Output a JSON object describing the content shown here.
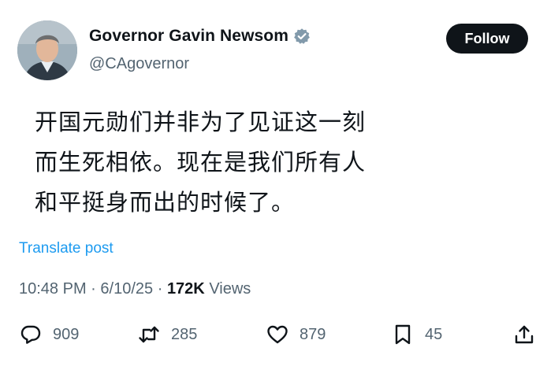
{
  "author": {
    "display_name": "Governor Gavin Newsom",
    "handle": "@CAgovernor",
    "verified_icon": "verified-badge-icon",
    "badge_color": "#829aab"
  },
  "follow_label": "Follow",
  "tweet": {
    "lines": [
      "开国元勋们并非为了见证这一刻",
      "而生死相依。现在是我们所有人",
      "和平挺身而出的时候了。"
    ]
  },
  "translate_label": "Translate post",
  "meta": {
    "time": "10:48 PM",
    "separator": "·",
    "date": "6/10/25",
    "views_count": "172K",
    "views_label": "Views"
  },
  "actions": {
    "replies": "909",
    "reposts": "285",
    "likes": "879",
    "bookmarks": "45"
  },
  "colors": {
    "text": "#0f1419",
    "secondary": "#536471",
    "link": "#1d9bf0",
    "button_bg": "#0f1419"
  }
}
